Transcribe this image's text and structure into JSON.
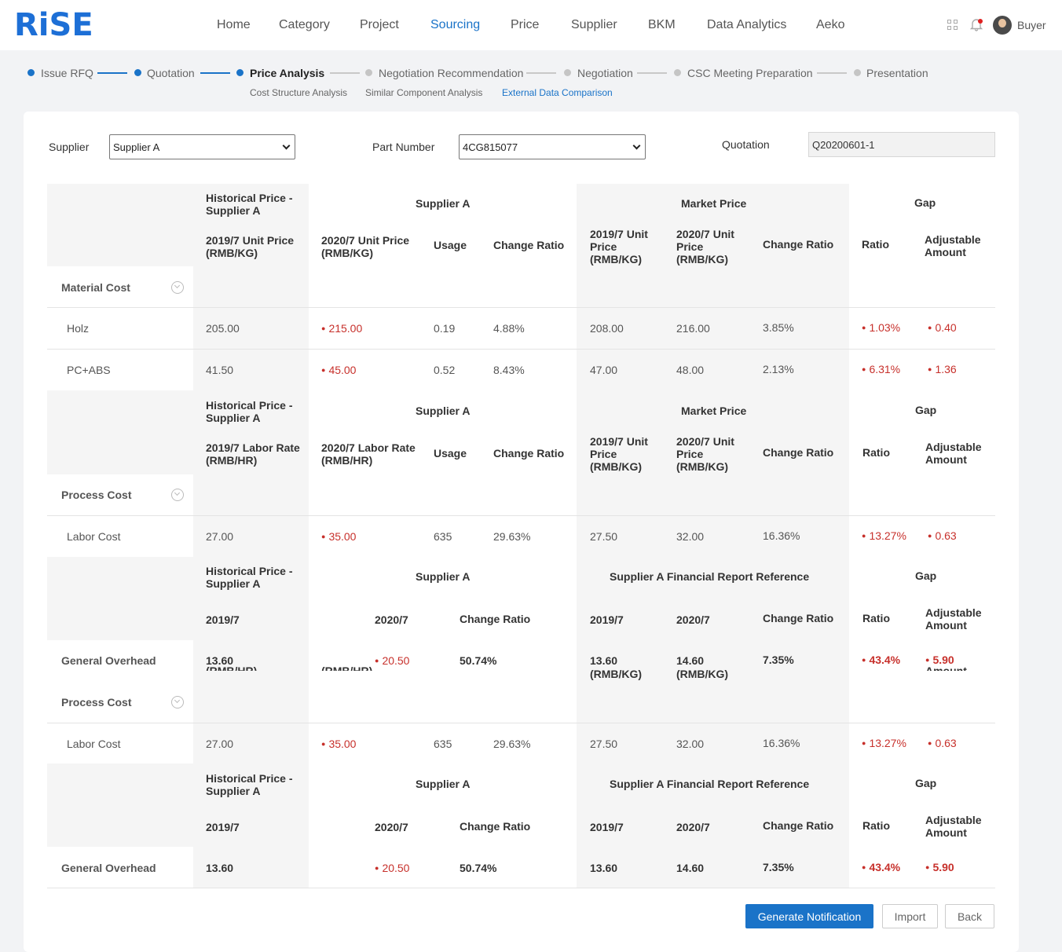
{
  "app": {
    "logo": "RiSE",
    "user": "Buyer"
  },
  "nav": [
    "Home",
    "Category",
    "Project",
    "Sourcing",
    "Price",
    "Supplier",
    "BKM",
    "Data Analytics",
    "Aeko"
  ],
  "steps": [
    "Issue RFQ",
    "Quotation",
    "Price Analysis",
    "Negotiation Recommendation",
    "Negotiation",
    "CSC Meeting Preparation",
    "Presentation"
  ],
  "substeps": [
    "Cost Structure Analysis",
    "Similar Component Analysis",
    "External Data Comparison"
  ],
  "filters": {
    "supplier_label": "Supplier",
    "supplier_value": "Supplier A",
    "part_label": "Part Number",
    "part_value": "4CG815077",
    "quotation_label": "Quotation",
    "quotation_value": "Q20200601-1"
  },
  "hdr1": {
    "hist": "Historical Price - Supplier A",
    "supA": "Supplier A",
    "market": "Market Price",
    "gap": "Gap",
    "c1": "2019/7 Unit Price (RMB/KG)",
    "c2": "2020/7 Unit Price (RMB/KG)",
    "usage": "Usage",
    "chg": "Change Ratio",
    "m1": "2019/7 Unit Price (RMB/KG)",
    "m2": "2020/7 Unit Price (RMB/KG)",
    "mchg": "Change Ratio",
    "ratio": "Ratio",
    "adj": "Adjustable Amount"
  },
  "material": {
    "label": "Material Cost",
    "rows": [
      {
        "name": "Holz",
        "h": "205.00",
        "s": "215.00",
        "u": "0.19",
        "c": "4.88%",
        "m1": "208.00",
        "m2": "216.00",
        "mc": "3.85%",
        "r": "1.03%",
        "a": "0.40"
      },
      {
        "name": "PC+ABS",
        "h": "41.50",
        "s": "45.00",
        "u": "0.52",
        "c": "8.43%",
        "m1": "47.00",
        "m2": "48.00",
        "mc": "2.13%",
        "r": "6.31%",
        "a": "1.36"
      }
    ]
  },
  "hdr2": {
    "hist": "Historical Price - Supplier A",
    "supA": "Supplier A",
    "market": "Market Price",
    "gap": "Gap",
    "c1": "2019/7 Labor Rate (RMB/HR)",
    "c2": "2020/7 Labor Rate (RMB/HR)",
    "usage": "Usage",
    "chg": "Change Ratio",
    "m1": "2019/7 Unit Price (RMB/KG)",
    "m2": "2020/7 Unit Price (RMB/KG)",
    "mchg": "Change Ratio",
    "ratio": "Ratio",
    "adj": "Adjustable Amount"
  },
  "process": {
    "label": "Process Cost",
    "row": {
      "name": "Labor Cost",
      "h": "27.00",
      "s": "35.00",
      "u": "635",
      "c": "29.63%",
      "m1": "27.50",
      "m2": "32.00",
      "mc": "16.36%",
      "r": "13.27%",
      "a": "0.63"
    }
  },
  "hdr3": {
    "hist": "Historical Price - Supplier A",
    "supA": "Supplier A",
    "fin": "Supplier A Financial Report Reference",
    "gap": "Gap",
    "c1": "2019/7",
    "c2": "2020/7",
    "chg": "Change Ratio",
    "f1": "2019/7",
    "f2": "2020/7",
    "fchg": "Change Ratio",
    "ratio": "Ratio",
    "adj": "Adjustable Amount"
  },
  "overhead": {
    "label": "General Overhead",
    "h": "13.60",
    "s": "20.50",
    "c": "50.74%",
    "f1": "13.60",
    "f2": "14.60",
    "fc": "7.35%",
    "r": "43.4%",
    "a": "5.90"
  },
  "ghost": {
    "c1": "(RMB/HR)",
    "c2": "(RMB/HR)",
    "m1": "(RMB/KG)",
    "m2": "(RMB/KG)",
    "adj": "Amount"
  },
  "buttons": {
    "generate": "Generate Notification",
    "import": "Import",
    "back": "Back"
  }
}
